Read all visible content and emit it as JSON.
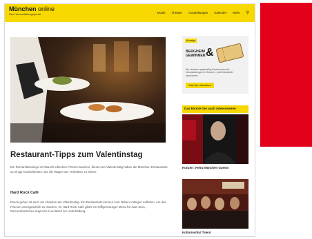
{
  "site": {
    "title_main": "München",
    "title_suffix": " online",
    "subtitle": "Dein Veranstaltungsportal"
  },
  "nav": {
    "items": [
      "Musik",
      "Theater",
      "Ausstellungen",
      "Kalender",
      "Mehr"
    ],
    "search_icon": "search-icon"
  },
  "article": {
    "headline": "Restaurant-Tipps zum Valentinstag",
    "intro": "Ein Romantikessinge im Rausch irdischen Pizzas maximen, diesen am Valentinstag haben die München Restaurants so einige Kostlichkeiten. Die die Wagen der Verliebten zu bieten.",
    "subhead": "Hard Rock Café",
    "body": "Essen gehen ist auch am Abseiten am Valentinstag. Ein Restaurants kennen zum Neben entlegen aufhelen, um das Fimmer unvergessbich zu machen. Im Hard Rock Café gibt's ein Riffiges Burger-Menü für zwei Euro, Memorefassiches angt eine Live-Band zur Unterhaltung."
  },
  "ad": {
    "tag": "Anzeige",
    "brand_line1": "BERGHEIM",
    "brand_line2": "GEWINNEN",
    "ampersand": "&",
    "text": "Wir verlosen regelmäßig Gewinnkarten für Veranstaltungen in München - jetzt Newsletter abonnieren!",
    "button": "Jetzt hier mitmachen"
  },
  "sidebar": {
    "heading": "Das könnte Sie auch interessieren",
    "cards": [
      {
        "caption": "Konzert: Heinz München Guests"
      },
      {
        "caption": "Kulturinstitut Talent"
      }
    ]
  },
  "colors": {
    "accent": "#f7d900",
    "red_block": "#e3001b"
  }
}
